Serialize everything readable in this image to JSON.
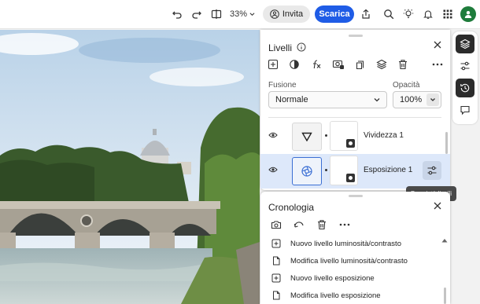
{
  "toolbar": {
    "zoom": "33%",
    "invite_label": "Invita",
    "download_label": "Scarica",
    "icons": [
      "undo-icon",
      "redo-icon",
      "compare-icon",
      "person-add-icon",
      "share-icon",
      "search-icon",
      "lightbulb-icon",
      "bell-icon",
      "apps-grid-icon",
      "user-avatar"
    ]
  },
  "rail": {
    "items": [
      "layers-icon",
      "adjustments-icon",
      "history-icon",
      "comment-icon"
    ],
    "active": "history-icon"
  },
  "layers_panel": {
    "title": "Livelli",
    "toolbar_icons": [
      "add-layer-icon",
      "adjustment-layer-icon",
      "fx-icon",
      "mask-icon",
      "duplicate-icon",
      "stack-icon",
      "trash-icon",
      "more-icon"
    ],
    "blend_label": "Fusione",
    "blend_value": "Normale",
    "opacity_label": "Opacità",
    "opacity_value": "100%",
    "layers": [
      {
        "name": "Vividezza 1",
        "selected": false
      },
      {
        "name": "Esposizione 1",
        "selected": true
      }
    ],
    "tooltip": "Proprietà livelli"
  },
  "history_panel": {
    "title": "Cronologia",
    "items": [
      "Nuovo livello luminosità/contrasto",
      "Modifica livello luminosità/contrasto",
      "Nuovo livello esposizione",
      "Modifica livello esposizione"
    ]
  },
  "colors": {
    "accent": "#1f5ce6",
    "selected_row": "#dde8fa",
    "avatar": "#1e7c3b"
  }
}
